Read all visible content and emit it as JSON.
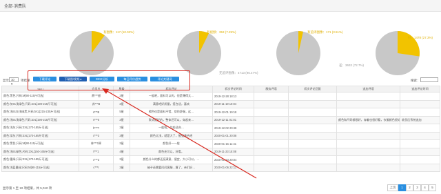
{
  "header": {
    "title": "全部·消费队"
  },
  "pies": [
    {
      "label": "有图像：117 (10.02%)",
      "color": "#f2c300",
      "fraction": 0.1002
    },
    {
      "label": "有视频：353 (7.25%)",
      "color": "#f2c300",
      "fraction": 0.0725
    },
    {
      "label": "有追评图像：171 (3.51%)",
      "other_label": "无追评图像：4713 (96.47%)",
      "color": "#f2c300",
      "fraction": 0.0351
    },
    {
      "label": "好：1478 (27.3%)",
      "other_label": "差：3632 (72.7%)",
      "color": "#f2c300",
      "fraction": 0.273
    }
  ],
  "controls": {
    "show_label": "显示",
    "page_size": "10",
    "unit_label": "项结果",
    "search_label": "搜索："
  },
  "buttons": [
    {
      "label": "下载评论"
    },
    {
      "label": "下载图/视频 ▸"
    },
    {
      "label": "DIKE分析"
    },
    {
      "label": "每日评价趋势"
    },
    {
      "label": "评论关键词"
    }
  ],
  "table": {
    "headers": [
      "SKU",
      "会员名",
      "星级",
      "初次评论",
      "初次评论时间",
      "服务评语",
      "初次评论回复",
      "追加评语",
      "追加评论时间"
    ],
    "rows": [
      [
        "颜色:黑色;尺码:M[90-115斤可选]",
        "燕***甜",
        "3星",
        "一般吧，面料可以的，但是薄得太…",
        "2019-12-28 18:13",
        "",
        "",
        "",
        ""
      ],
      [
        "颜色:灰91浅绿色;尺码:4XL[190-215斤可选]",
        "苏***B",
        "3星",
        "满意吧好质量，挺合适，喜欢",
        "2019-11-19 10:04",
        "",
        "",
        "",
        ""
      ],
      [
        "颜色:浅91灰浅绿黑;尺码:5XL[215-230斤可选]",
        "s***B",
        "5星",
        "褐色也是面料不错，穿的舒服，这…",
        "2019-12-01 19:18",
        "",
        "",
        "",
        ""
      ],
      [
        "颜色:浅91浅绿色;尺码:3XL[190-215斤可选]",
        "s***0",
        "3星",
        "款式挺好的，整体还可以，穿起来…",
        "2019-12-11 01:01",
        "",
        "",
        "颜色和尺码都很好，穿着也很好看，衣服颜色很好看…",
        "收货后系统追加"
      ],
      [
        "颜色:浅灰;尺码:3XL[170-185斤可选]",
        "h***?",
        "3星",
        "一般啦，比较适合…",
        "2019-12-02 20:48",
        "",
        "",
        "",
        ""
      ],
      [
        "颜色:深灰;尺码:3XL[170-185斤可选]",
        "c***3",
        "3星",
        "颜色太浅，就是大了，勉强凑合吧",
        "2020-01-01 20:08",
        "",
        "",
        "",
        ""
      ],
      [
        "颜色:黑色;尺码:M[90-115斤可选]",
        "林***1辉",
        "3星",
        "颜色好一一般",
        "2020-01-15 11:41",
        "",
        "",
        "",
        ""
      ],
      [
        "颜色:浅91绿色;尺码:2XL[150-165斤可选]",
        "t***1",
        "4星",
        "颜色还可以，好看，",
        "2019-11-23 15:08",
        "",
        "",
        "",
        ""
      ],
      [
        "颜色:墨绿;尺码:3XL[170-185斤可选]",
        "c***3",
        "3星",
        "颜色什么的都还挺满意，便宜，大小可以，…",
        "2020-01-23 20:04",
        "",
        "",
        "",
        ""
      ],
      [
        "颜色:浅蓝墨绿;尺码:M[90-115斤可选]",
        "c***r",
        "3星",
        "袖子还需要问问客服…算了，亲们好…",
        "2020-01-06 22:13",
        "",
        "",
        "",
        ""
      ]
    ]
  },
  "footer": {
    "summary": "显示第 1 至 10 项结果，共 5,010 项"
  },
  "pagination": [
    "上页",
    "1",
    "2",
    "3",
    "4",
    "5"
  ]
}
